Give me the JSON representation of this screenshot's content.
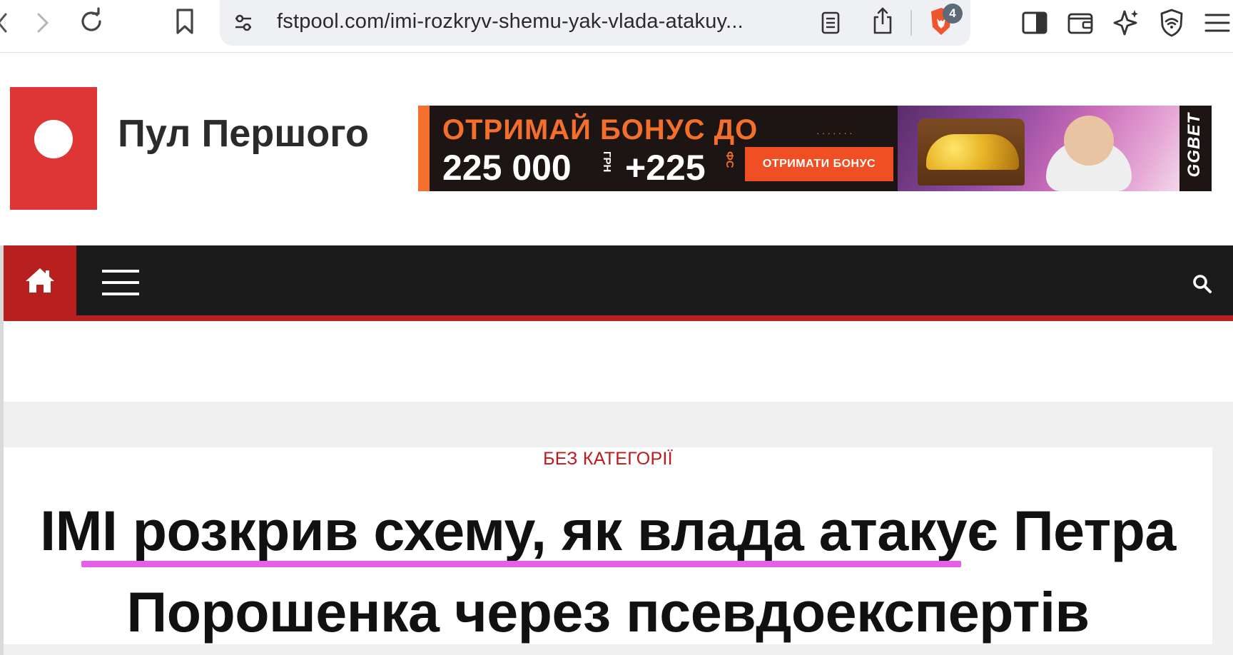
{
  "browser": {
    "url": "fstpool.com/imi-rozkryv-shemu-yak-vlada-atakuy...",
    "shields_count": "4"
  },
  "site": {
    "name": "Пул Першого"
  },
  "ad": {
    "headline": "ОТРИМАЙ БОНУС ДО",
    "amount": "225 000",
    "currency": "ГРН",
    "plus_value": "+225",
    "free_spins": "ФС",
    "cta": "ОТРИМАТИ БОНУС",
    "brand": "GGBET",
    "accent_color": "#f36f2b"
  },
  "nav": {
    "home_icon": "home-icon",
    "menu_icon": "hamburger-icon",
    "search_icon": "search-icon",
    "accent_color": "#b81f1f"
  },
  "article": {
    "category": "БЕЗ КАТЕГОРІЇ",
    "title": "IMI розкрив схему, як влада атакує Петра Порошенка через псевдоекспертів"
  }
}
